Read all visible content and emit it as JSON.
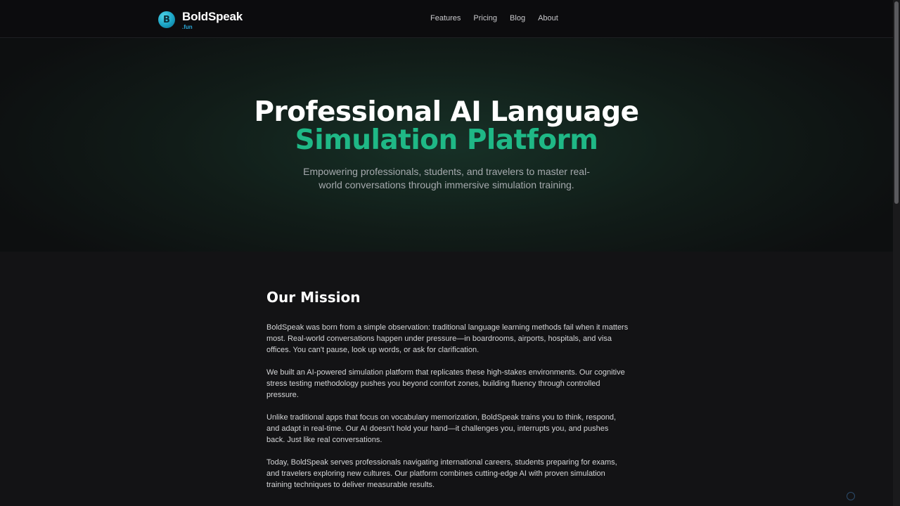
{
  "header": {
    "logo_letter": "B",
    "logo_name": "BoldSpeak",
    "logo_tld": ".fun",
    "nav": [
      {
        "label": "Features"
      },
      {
        "label": "Pricing"
      },
      {
        "label": "Blog"
      },
      {
        "label": "About"
      }
    ]
  },
  "hero": {
    "title_line1": "Professional AI Language",
    "title_line2": "Simulation Platform",
    "subtitle": "Empowering professionals, students, and travelers to master real-world conversations through immersive simulation training."
  },
  "mission": {
    "title": "Our Mission",
    "paragraphs": [
      "BoldSpeak was born from a simple observation: traditional language learning methods fail when it matters most. Real-world conversations happen under pressure—in boardrooms, airports, hospitals, and visa offices. You can't pause, look up words, or ask for clarification.",
      "We built an AI-powered simulation platform that replicates these high-stakes environments. Our cognitive stress testing methodology pushes you beyond comfort zones, building fluency through controlled pressure.",
      "Unlike traditional apps that focus on vocabulary memorization, BoldSpeak trains you to think, respond, and adapt in real-time. Our AI doesn't hold your hand—it challenges you, interrupts you, and pushes back. Just like real conversations.",
      "Today, BoldSpeak serves professionals navigating international careers, students preparing for exams, and travelers exploring new cultures. Our platform combines cutting-edge AI with proven simulation training techniques to deliver measurable results."
    ]
  },
  "colors": {
    "accent_green": "#1fb886",
    "logo_blue": "#2aa7d8",
    "background": "#131315"
  }
}
